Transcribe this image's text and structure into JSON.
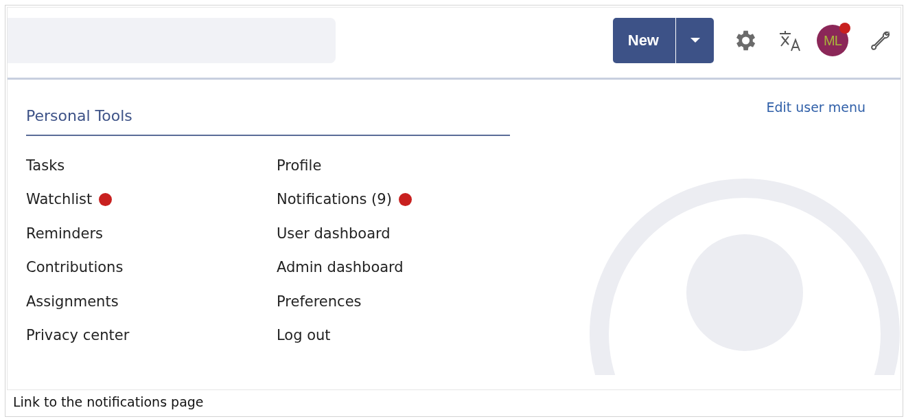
{
  "header": {
    "new_button": {
      "label": "New"
    },
    "avatar": {
      "initials": "ML",
      "notification": true
    }
  },
  "menu": {
    "title": "Personal Tools",
    "edit_link": "Edit user menu",
    "columns": [
      [
        {
          "label": "Tasks",
          "badge": false
        },
        {
          "label": "Watchlist",
          "badge": true
        },
        {
          "label": "Reminders",
          "badge": false
        },
        {
          "label": "Contributions",
          "badge": false
        },
        {
          "label": "Assignments",
          "badge": false
        },
        {
          "label": "Privacy center",
          "badge": false
        }
      ],
      [
        {
          "label": "Profile",
          "badge": false
        },
        {
          "label": "Notifications (9)",
          "badge": true
        },
        {
          "label": "User dashboard",
          "badge": false
        },
        {
          "label": "Admin dashboard",
          "badge": false
        },
        {
          "label": "Preferences",
          "badge": false
        },
        {
          "label": "Log out",
          "badge": false
        }
      ]
    ]
  },
  "caption": "Link to the notifications page"
}
